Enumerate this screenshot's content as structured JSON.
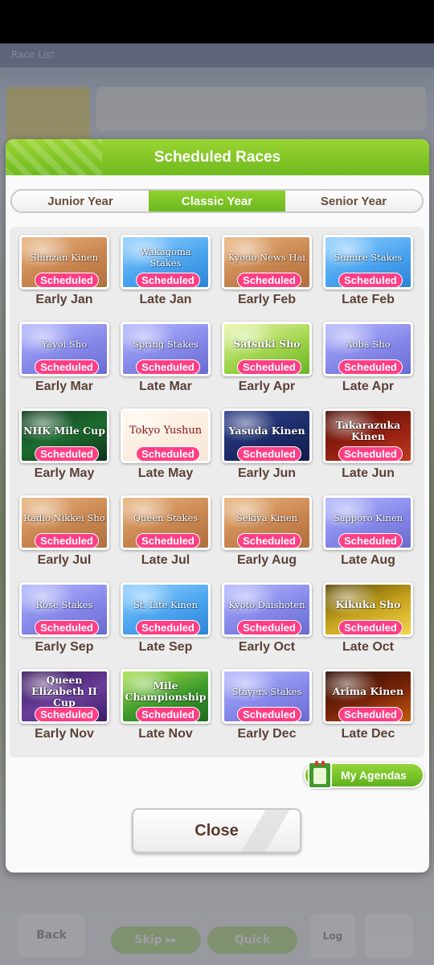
{
  "background": {
    "header_text": "Race List",
    "bottom_buttons": [
      "Back",
      "Skip ▸▸",
      "Quick",
      "Log"
    ]
  },
  "modal": {
    "title": "Scheduled Races",
    "tabs": [
      {
        "label": "Junior Year",
        "active": false
      },
      {
        "label": "Classic Year",
        "active": true
      },
      {
        "label": "Senior Year",
        "active": false
      }
    ],
    "races": [
      {
        "name": "Shinzan Kinen",
        "status": "Scheduled",
        "date": "Early Jan",
        "theme": "bronze"
      },
      {
        "name": "Wakagoma Stakes",
        "status": "Scheduled",
        "date": "Late Jan",
        "theme": "blue"
      },
      {
        "name": "Kyodo News Hai",
        "status": "Scheduled",
        "date": "Early Feb",
        "theme": "bronze"
      },
      {
        "name": "Sumire Stakes",
        "status": "Scheduled",
        "date": "Late Feb",
        "theme": "blue"
      },
      {
        "name": "Yayoi Sho",
        "status": "Scheduled",
        "date": "Early Mar",
        "theme": "purple"
      },
      {
        "name": "Spring Stakes",
        "status": "Scheduled",
        "date": "Late Mar",
        "theme": "purple"
      },
      {
        "name": "Satsuki Sho",
        "status": "Scheduled",
        "date": "Early Apr",
        "theme": "green"
      },
      {
        "name": "Aoba Sho",
        "status": "Scheduled",
        "date": "Late Apr",
        "theme": "purple"
      },
      {
        "name": "NHK Mile Cup",
        "status": "Scheduled",
        "date": "Early May",
        "theme": "nhk"
      },
      {
        "name": "Tokyo Yushun",
        "status": "Scheduled",
        "date": "Late May",
        "theme": "tokyo"
      },
      {
        "name": "Yasuda Kinen",
        "status": "Scheduled",
        "date": "Early Jun",
        "theme": "yasuda"
      },
      {
        "name": "Takarazuka Kinen",
        "status": "Scheduled",
        "date": "Late Jun",
        "theme": "takarazuka"
      },
      {
        "name": "Radio Nikkei Sho",
        "status": "Scheduled",
        "date": "Early Jul",
        "theme": "bronze"
      },
      {
        "name": "Queen Stakes",
        "status": "Scheduled",
        "date": "Late Jul",
        "theme": "bronze"
      },
      {
        "name": "Sekiya Kinen",
        "status": "Scheduled",
        "date": "Early Aug",
        "theme": "bronze"
      },
      {
        "name": "Sapporo Kinen",
        "status": "Scheduled",
        "date": "Late Aug",
        "theme": "purple"
      },
      {
        "name": "Rose Stakes",
        "status": "Scheduled",
        "date": "Early Sep",
        "theme": "purple"
      },
      {
        "name": "St. Lite Kinen",
        "status": "Scheduled",
        "date": "Late Sep",
        "theme": "blue"
      },
      {
        "name": "Kyoto Daishoten",
        "status": "Scheduled",
        "date": "Early Oct",
        "theme": "purple"
      },
      {
        "name": "Kikuka Sho",
        "status": "Scheduled",
        "date": "Late Oct",
        "theme": "kikuka"
      },
      {
        "name": "Queen Elizabeth II Cup",
        "status": "Scheduled",
        "date": "Early Nov",
        "theme": "queen"
      },
      {
        "name": "Mile Championship",
        "status": "Scheduled",
        "date": "Late Nov",
        "theme": "mile"
      },
      {
        "name": "Stayers Stakes",
        "status": "Scheduled",
        "date": "Early Dec",
        "theme": "purple"
      },
      {
        "name": "Arima Kinen",
        "status": "Scheduled",
        "date": "Late Dec",
        "theme": "arima"
      }
    ],
    "my_agendas_label": "My Agendas",
    "close_label": "Close"
  }
}
